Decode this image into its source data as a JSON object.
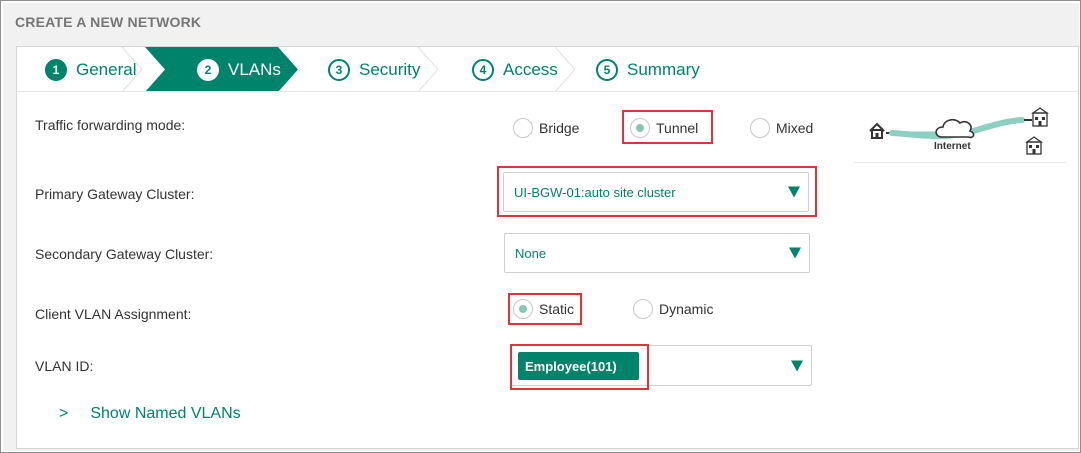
{
  "page": {
    "title": "CREATE A NEW NETWORK"
  },
  "steps": [
    {
      "num": "1",
      "label": "General",
      "state": "done"
    },
    {
      "num": "2",
      "label": "VLANs",
      "state": "active"
    },
    {
      "num": "3",
      "label": "Security",
      "state": "pending"
    },
    {
      "num": "4",
      "label": "Access",
      "state": "pending"
    },
    {
      "num": "5",
      "label": "Summary",
      "state": "pending"
    }
  ],
  "traffic": {
    "label": "Traffic forwarding mode:",
    "options": [
      "Bridge",
      "Tunnel",
      "Mixed"
    ],
    "selected": "Tunnel"
  },
  "primary_gateway": {
    "label": "Primary Gateway Cluster:",
    "value": "UI-BGW-01:auto site cluster"
  },
  "secondary_gateway": {
    "label": "Secondary Gateway Cluster:",
    "value": "None"
  },
  "client_vlan": {
    "label": "Client VLAN Assignment:",
    "options": [
      "Static",
      "Dynamic"
    ],
    "selected": "Static"
  },
  "vlan_id": {
    "label": "VLAN ID:",
    "chip": "Employee(101)"
  },
  "named_vlans": {
    "caret": ">",
    "label": "Show Named VLANs"
  },
  "diagram": {
    "internet_label": "Internet"
  },
  "colors": {
    "accent": "#00836b",
    "highlight": "#e2333a",
    "radio_dot": "#86c8b5"
  },
  "icons": [
    "home-icon",
    "cloud-icon",
    "building-icon",
    "chevron-down-icon",
    "chevron-right-icon"
  ]
}
